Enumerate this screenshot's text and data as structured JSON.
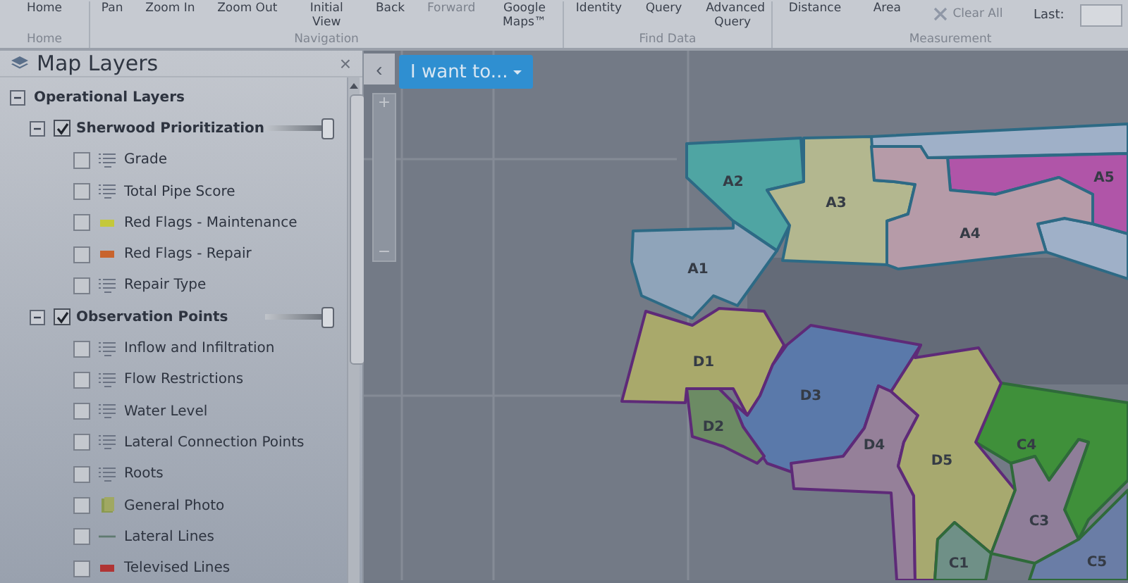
{
  "ribbon": {
    "groups": [
      {
        "label": "Home",
        "buttons": [
          {
            "label": "Home",
            "disabled": false
          }
        ]
      },
      {
        "label": "Navigation",
        "buttons": [
          {
            "label": "Pan",
            "disabled": false
          },
          {
            "label": "Zoom In",
            "disabled": false
          },
          {
            "label": "Zoom Out",
            "disabled": false
          },
          {
            "label": "Initial View",
            "disabled": false
          },
          {
            "label": "Back",
            "disabled": false
          },
          {
            "label": "Forward",
            "disabled": true
          },
          {
            "label": "Google Maps™",
            "disabled": false
          }
        ]
      },
      {
        "label": "Find Data",
        "buttons": [
          {
            "label": "Identity",
            "disabled": false
          },
          {
            "label": "Query",
            "disabled": false
          },
          {
            "label": "Advanced Query",
            "disabled": false
          }
        ]
      },
      {
        "label": "Measurement",
        "buttons": [
          {
            "label": "Distance",
            "disabled": false
          },
          {
            "label": "Area",
            "disabled": false
          },
          {
            "label": "Clear All",
            "disabled": true,
            "kind": "clear"
          }
        ],
        "field": {
          "label": "Last:"
        }
      }
    ]
  },
  "panel": {
    "title": "Map Layers",
    "close": "×"
  },
  "layers": [
    {
      "label": "Operational Layers",
      "expanded": true,
      "children": [
        {
          "label": "Sherwood Prioritization",
          "checked": true,
          "expanded": true,
          "level": 1,
          "children": [
            {
              "label": "Grade",
              "checked": false,
              "kind": "legend"
            },
            {
              "label": "Total Pipe Score",
              "checked": false,
              "kind": "legend"
            },
            {
              "label": "Red Flags - Maintenance",
              "checked": false,
              "kind": "swatch",
              "color": "#c4c83a"
            },
            {
              "label": "Red Flags - Repair",
              "checked": false,
              "kind": "swatch",
              "color": "#c8642d"
            },
            {
              "label": "Repair Type",
              "checked": false,
              "kind": "legend"
            }
          ]
        },
        {
          "label": "Observation Points",
          "checked": true,
          "expanded": true,
          "level": 1,
          "children": [
            {
              "label": "Inflow and Infiltration",
              "checked": false,
              "kind": "legend"
            },
            {
              "label": "Flow Restrictions",
              "checked": false,
              "kind": "legend"
            },
            {
              "label": "Water Level",
              "checked": false,
              "kind": "legend"
            },
            {
              "label": "Lateral Connection Points",
              "checked": false,
              "kind": "legend"
            },
            {
              "label": "Roots",
              "checked": false,
              "kind": "legend"
            },
            {
              "label": "General Photo",
              "checked": false,
              "kind": "photo"
            },
            {
              "label": "Lateral Lines",
              "checked": false,
              "kind": "line"
            },
            {
              "label": "Televised Lines",
              "checked": false,
              "kind": "swatch",
              "color": "#b03434"
            }
          ]
        }
      ]
    }
  ],
  "map": {
    "menu_button": "I want to...",
    "collapse": "‹",
    "zoom_in": "+",
    "zoom_out": "−",
    "regions": [
      {
        "label": "A2",
        "color": "#4fa5a3"
      },
      {
        "label": "A5",
        "color": "#b055a8"
      },
      {
        "label": "A3",
        "color": "#b3b78f"
      },
      {
        "label": "A4",
        "color": "#b69ba8"
      },
      {
        "label": "A1",
        "color": "#8fa4ba"
      },
      {
        "label": "D1",
        "color": "#a9a96b"
      },
      {
        "label": "D3",
        "color": "#5a79aa"
      },
      {
        "label": "D2",
        "color": "#6c8b64"
      },
      {
        "label": "D4",
        "color": "#958099"
      },
      {
        "label": "C4",
        "color": "#3f903a"
      },
      {
        "label": "D5",
        "color": "#a7a96f"
      },
      {
        "label": "C3",
        "color": "#8f7e99"
      },
      {
        "label": "C1",
        "color": "#6f9087"
      },
      {
        "label": "C5",
        "color": "#6a7da6"
      }
    ]
  }
}
